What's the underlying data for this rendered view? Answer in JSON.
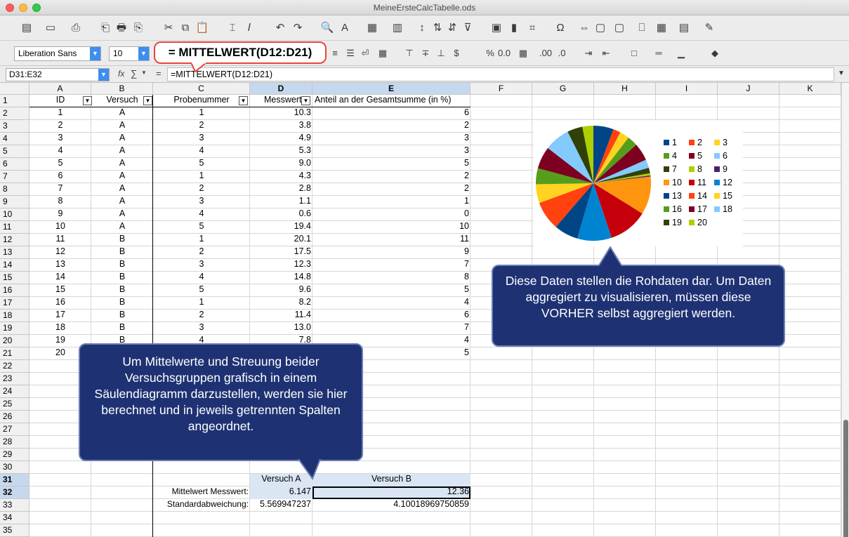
{
  "window": {
    "title": "MeineErsteCalcTabelle.ods"
  },
  "toolbar": {
    "font_name": "Liberation Sans",
    "font_size": "10",
    "icons": [
      "new-icon",
      "open-icon",
      "save-icon",
      "export-pdf-icon",
      "print-icon",
      "print-preview-icon",
      "cut-icon",
      "copy-icon",
      "paste-icon",
      "clone-formatting-icon",
      "clear-formatting-icon",
      "undo-icon",
      "redo-icon",
      "find-replace-icon",
      "spelling-icon",
      "row-icon",
      "column-icon",
      "sort-icon",
      "sort-ascending-icon",
      "sort-descending-icon",
      "autofilter-icon",
      "image-icon",
      "chart-icon",
      "pivot-table-icon",
      "special-character-icon",
      "hyperlink-icon",
      "comment-icon",
      "headers-footers-icon",
      "define-print-area-icon",
      "freeze-icon",
      "split-window-icon",
      "show-draw-functions-icon"
    ],
    "formatting_icons": [
      "align-left-icon",
      "align-center-icon",
      "align-right-icon",
      "justify-icon",
      "wrap-text-icon",
      "merge-center-icon",
      "align-top-icon",
      "center-vertically-icon",
      "align-bottom-icon",
      "currency-icon",
      "percent-icon",
      "number-icon",
      "date-icon",
      "add-decimal-icon",
      "delete-decimal-icon",
      "increase-indent-icon",
      "decrease-indent-icon",
      "borders-icon",
      "border-style-icon",
      "border-color-icon",
      "conditional-icon"
    ]
  },
  "formula_bar": {
    "cell_ref": "D31:E32",
    "fx": "fx",
    "sum": "∑",
    "equals": "=",
    "formula": "=MITTELWERT(D12:D21)"
  },
  "formula_callout": "= MITTELWERT(D12:D21)",
  "columns": [
    "A",
    "B",
    "C",
    "D",
    "E",
    "F",
    "G",
    "H",
    "I",
    "J",
    "K"
  ],
  "header_row": {
    "id": "ID",
    "versuch": "Versuch",
    "probe": "Probenummer",
    "messwert": "Messwert",
    "anteil": "Anteil an der Gesamtsumme (in %)"
  },
  "rows": [
    {
      "id": "1",
      "v": "A",
      "p": "1",
      "m": "10.3",
      "a": "6"
    },
    {
      "id": "2",
      "v": "A",
      "p": "2",
      "m": "3.8",
      "a": "2"
    },
    {
      "id": "3",
      "v": "A",
      "p": "3",
      "m": "4.9",
      "a": "3"
    },
    {
      "id": "4",
      "v": "A",
      "p": "4",
      "m": "5.3",
      "a": "3"
    },
    {
      "id": "5",
      "v": "A",
      "p": "5",
      "m": "9.0",
      "a": "5"
    },
    {
      "id": "6",
      "v": "A",
      "p": "1",
      "m": "4.3",
      "a": "2"
    },
    {
      "id": "7",
      "v": "A",
      "p": "2",
      "m": "2.8",
      "a": "2"
    },
    {
      "id": "8",
      "v": "A",
      "p": "3",
      "m": "1.1",
      "a": "1"
    },
    {
      "id": "9",
      "v": "A",
      "p": "4",
      "m": "0.6",
      "a": "0"
    },
    {
      "id": "10",
      "v": "A",
      "p": "5",
      "m": "19.4",
      "a": "10"
    },
    {
      "id": "11",
      "v": "B",
      "p": "1",
      "m": "20.1",
      "a": "11"
    },
    {
      "id": "12",
      "v": "B",
      "p": "2",
      "m": "17.5",
      "a": "9"
    },
    {
      "id": "13",
      "v": "B",
      "p": "3",
      "m": "12.3",
      "a": "7"
    },
    {
      "id": "14",
      "v": "B",
      "p": "4",
      "m": "14.8",
      "a": "8"
    },
    {
      "id": "15",
      "v": "B",
      "p": "5",
      "m": "9.6",
      "a": "5"
    },
    {
      "id": "16",
      "v": "B",
      "p": "1",
      "m": "8.2",
      "a": "4"
    },
    {
      "id": "17",
      "v": "B",
      "p": "2",
      "m": "11.4",
      "a": "6"
    },
    {
      "id": "18",
      "v": "B",
      "p": "3",
      "m": "13.0",
      "a": "7"
    },
    {
      "id": "19",
      "v": "B",
      "p": "4",
      "m": "7.8",
      "a": "4"
    },
    {
      "id": "20",
      "v": "",
      "p": "",
      "m": "",
      "a": "5"
    }
  ],
  "summary": {
    "d31": "Versuch A",
    "e31": "Versuch B",
    "c32": "Mittelwert Messwert:",
    "d32": "6.147",
    "e32": "12.36",
    "c33": "Standardabweichung:",
    "d33": "5.569947237",
    "e33": "4.10018969750859"
  },
  "callouts": {
    "pie": "Diese Daten stellen die Rohdaten dar. Um Daten aggregiert zu visualisieren, müssen diese VORHER selbst aggregiert werden.",
    "left": "Um Mittelwerte und Streuung beider Versuchsgruppen grafisch in einem Säulendiagramm darzustellen, werden sie hier berechnet und in jeweils getrennten Spalten angeordnet."
  },
  "chart_data": {
    "type": "pie",
    "categories": [
      "1",
      "2",
      "3",
      "4",
      "5",
      "6",
      "7",
      "8",
      "9",
      "10",
      "11",
      "12",
      "13",
      "14",
      "15",
      "16",
      "17",
      "18",
      "19",
      "20"
    ],
    "values": [
      10.3,
      3.8,
      4.9,
      5.3,
      9.0,
      4.3,
      2.8,
      1.1,
      0.6,
      19.4,
      20.1,
      17.5,
      12.3,
      14.8,
      9.6,
      8.2,
      11.4,
      13.0,
      7.8,
      5.6
    ],
    "colors": [
      "#004586",
      "#ff420e",
      "#ffd320",
      "#579d1c",
      "#7e0021",
      "#83caff",
      "#314004",
      "#aecf00",
      "#4b1f6f",
      "#ff950e",
      "#c5000b",
      "#0084d1",
      "#004586",
      "#ff420e",
      "#ffd320",
      "#579d1c",
      "#7e0021",
      "#83caff",
      "#314004",
      "#aecf00"
    ],
    "legend_position": "right"
  }
}
